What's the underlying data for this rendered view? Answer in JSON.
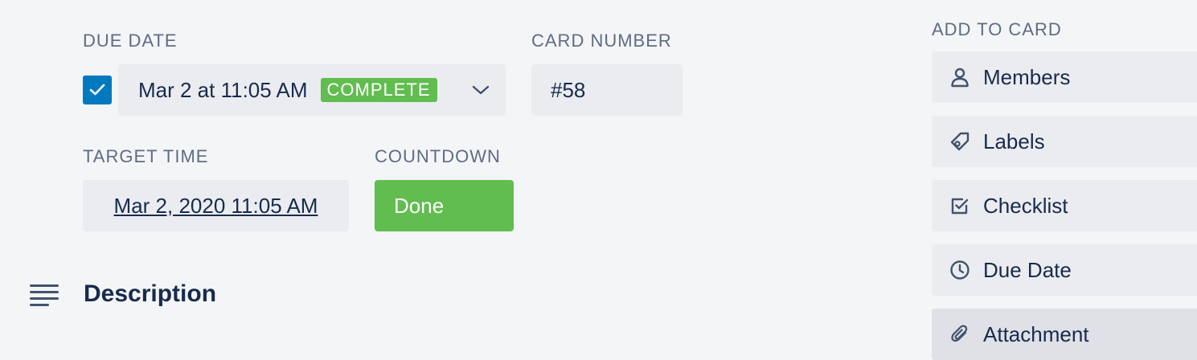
{
  "due_date": {
    "label": "DUE DATE",
    "value": "Mar 2 at 11:05 AM",
    "badge": "COMPLETE",
    "checked": true
  },
  "card_number": {
    "label": "CARD NUMBER",
    "value": "#58"
  },
  "target_time": {
    "label": "TARGET TIME",
    "value": "Mar 2, 2020 11:05 AM"
  },
  "countdown": {
    "label": "COUNTDOWN",
    "value": "Done"
  },
  "description": {
    "title": "Description"
  },
  "add_to_card": {
    "heading": "ADD TO CARD",
    "items": [
      {
        "label": "Members",
        "icon": "person-icon"
      },
      {
        "label": "Labels",
        "icon": "tag-icon"
      },
      {
        "label": "Checklist",
        "icon": "checklist-icon"
      },
      {
        "label": "Due Date",
        "icon": "clock-icon"
      },
      {
        "label": "Attachment",
        "icon": "paperclip-icon"
      }
    ]
  },
  "colors": {
    "background": "#f4f5f7",
    "field": "#ebecf0",
    "checkbox": "#0079bf",
    "success": "#61bd4f",
    "text": "#172b4d",
    "muted": "#5e6c84"
  }
}
